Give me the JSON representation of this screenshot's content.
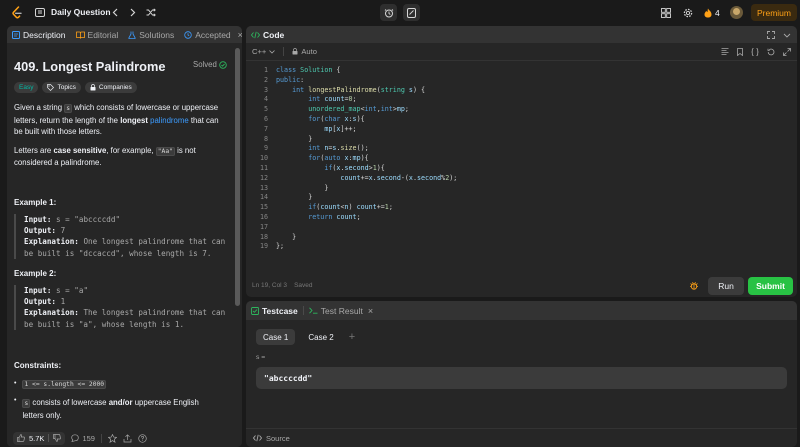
{
  "topbar": {
    "title": "Daily Question",
    "streak": "4",
    "premium": "Premium"
  },
  "left_panel": {
    "tabs": [
      "Description",
      "Editorial",
      "Solutions",
      "Accepted"
    ],
    "problem_title": "409. Longest Palindrome",
    "status": "Solved",
    "difficulty": "Easy",
    "tags": [
      "Topics",
      "Companies"
    ],
    "desc1_a": "Given a string",
    "desc1_code1": "s",
    "desc1_b": "which consists of lowercase or uppercase letters, return the length of the",
    "desc1_bold": "longest",
    "desc1_link": "palindrome",
    "desc1_c": "that can be built with those letters.",
    "desc2_a": "Letters are",
    "desc2_bold": "case sensitive",
    "desc2_b": ", for example,",
    "desc2_code": "\"Aa\"",
    "desc2_c": "is not considered a palindrome.",
    "example1_title": "Example 1:",
    "example1_input_label": "Input:",
    "example1_input": "s = \"abccccdd\"",
    "example1_output_label": "Output:",
    "example1_output": "7",
    "example1_expl_label": "Explanation:",
    "example1_expl_l1": "One longest palindrome that can",
    "example1_expl_l2": "be built is \"dccaccd\", whose length is 7.",
    "example2_title": "Example 2:",
    "example2_input_label": "Input:",
    "example2_input": "s = \"a\"",
    "example2_output_label": "Output:",
    "example2_output": "1",
    "example2_expl_label": "Explanation:",
    "example2_expl_l1": "The longest palindrome that can",
    "example2_expl_l2": "be built is \"a\", whose length is 1.",
    "constraints_title": "Constraints:",
    "constraint1": "1 <= s.length <= 2000",
    "constraint2_code": "s",
    "constraint2_a": "consists of lowercase",
    "constraint2_bold": "and/or",
    "constraint2_b": "uppercase English letters only.",
    "likes": "5.7K",
    "comments": "159"
  },
  "code_panel": {
    "tab": "Code",
    "language": "C++",
    "mode": "Auto",
    "cursor": "Ln 19, Col 3",
    "saved": "Saved",
    "run": "Run",
    "submit": "Submit",
    "line_numbers": [
      "1",
      "2",
      "3",
      "4",
      "5",
      "6",
      "7",
      "8",
      "9",
      "10",
      "11",
      "12",
      "13",
      "14",
      "15",
      "16",
      "17",
      "18",
      "19"
    ]
  },
  "test_panel": {
    "tab_testcase": "Testcase",
    "tab_result": "Test Result",
    "cases": [
      "Case 1",
      "Case 2"
    ],
    "var_label": "s =",
    "var_value": "\"abccccdd\"",
    "source": "Source"
  },
  "colors": {
    "accent": "#ffa116",
    "easy": "#00b8a3",
    "link": "#3c9cff",
    "submit": "#28c244",
    "solved": "#2db55d"
  }
}
